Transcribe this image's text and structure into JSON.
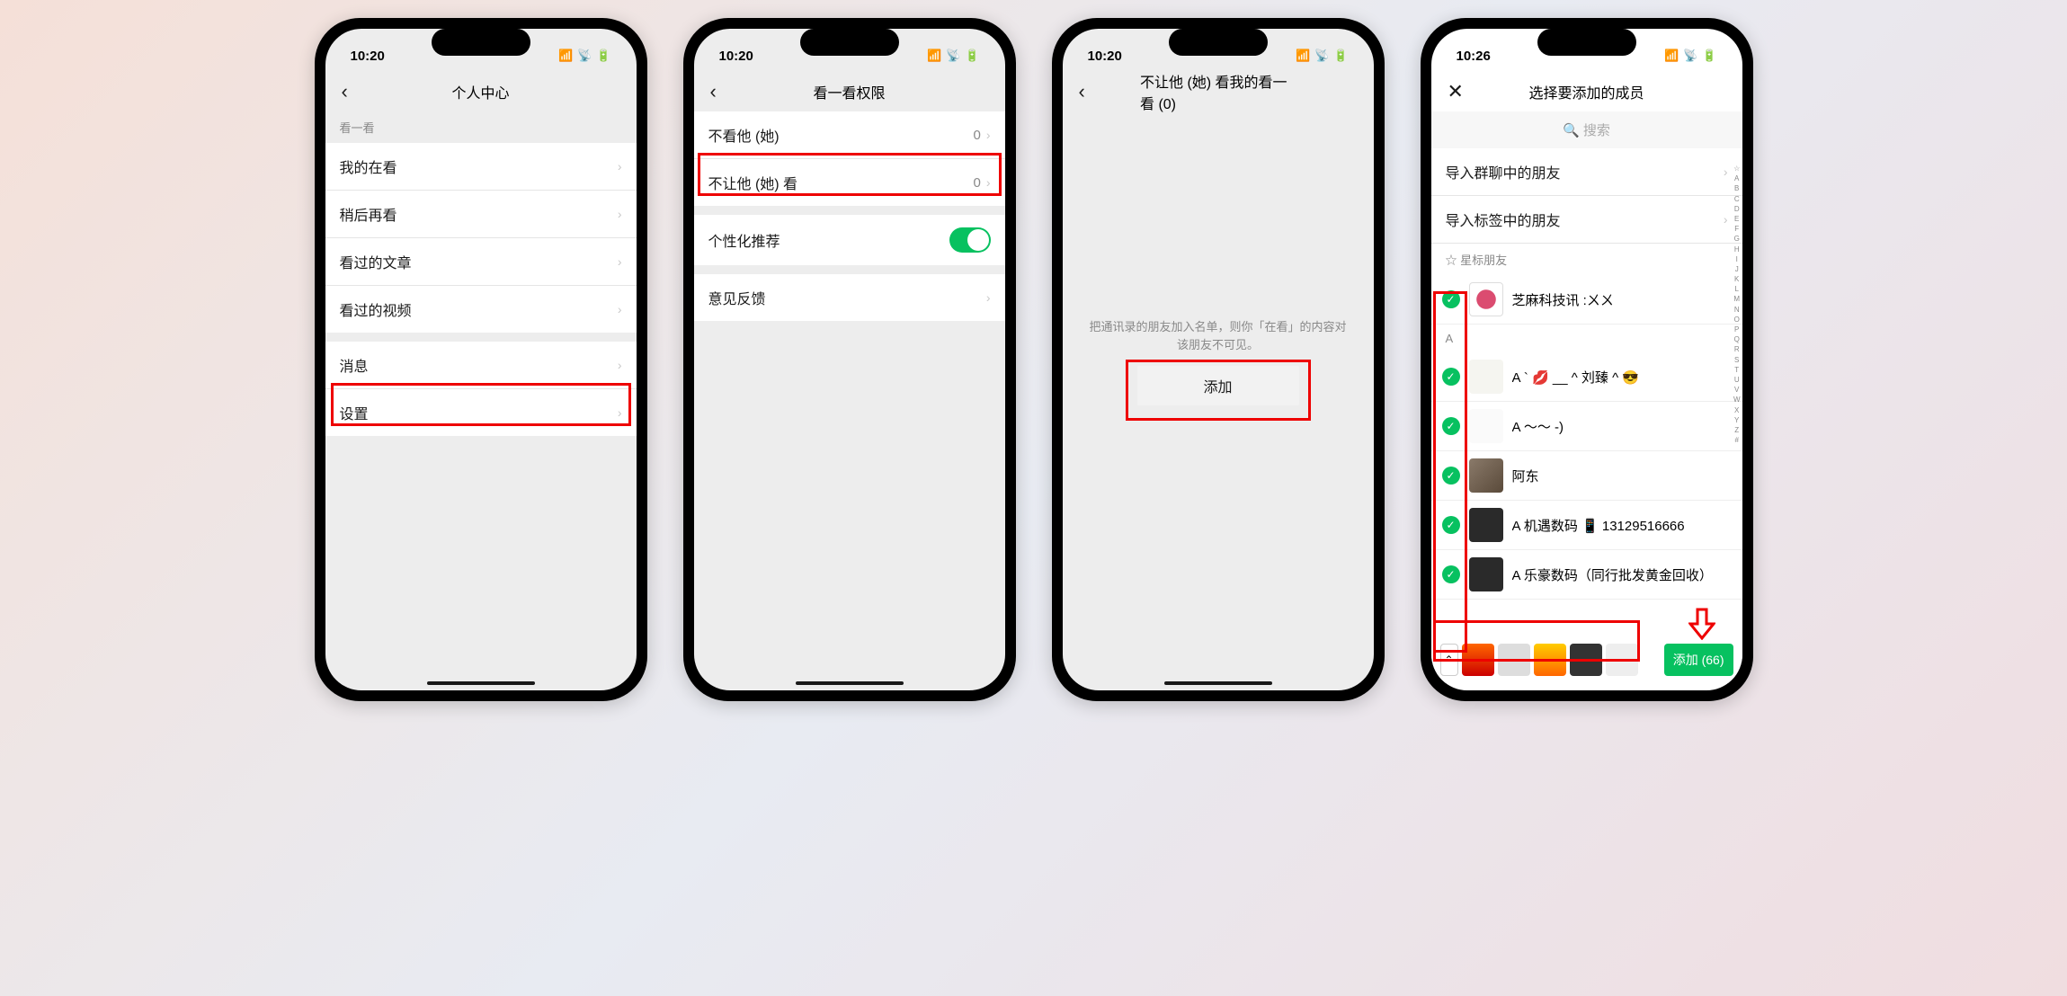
{
  "screen1": {
    "time": "10:20",
    "title": "个人中心",
    "section": "看一看",
    "items": [
      "我的在看",
      "稍后再看",
      "看过的文章",
      "看过的视频"
    ],
    "items2": [
      "消息",
      "设置"
    ]
  },
  "screen2": {
    "time": "10:20",
    "title": "看一看权限",
    "item1": {
      "label": "不看他 (她)",
      "value": "0"
    },
    "item2": {
      "label": "不让他 (她) 看",
      "value": "0"
    },
    "item3": {
      "label": "个性化推荐"
    },
    "item4": {
      "label": "意见反馈"
    }
  },
  "screen3": {
    "time": "10:20",
    "title": "不让他 (她) 看我的看一看 (0)",
    "hint": "把通讯录的朋友加入名单，则你「在看」的内容对该朋友不可见。",
    "add": "添加"
  },
  "screen4": {
    "time": "10:26",
    "title": "选择要添加的成员",
    "search": "搜索",
    "import1": "导入群聊中的朋友",
    "import2": "导入标签中的朋友",
    "star_section": "星标朋友",
    "a_section": "A",
    "contacts": [
      {
        "name": "芝麻科技讯 :ㄨㄨ"
      },
      {
        "name": "A  ` 💋 __ ^ 刘臻 ^ 😎"
      },
      {
        "name": "A ～～ -)"
      },
      {
        "name": "阿东"
      },
      {
        "name": "A 机遇数码 📱 13129516666"
      },
      {
        "name": "A 乐豪数码（同行批发黄金回收）"
      }
    ],
    "index": "☆ A B C D E F G H I J K L M N O P Q R S T U V W X Y Z #",
    "confirm": "添加 (66)"
  }
}
